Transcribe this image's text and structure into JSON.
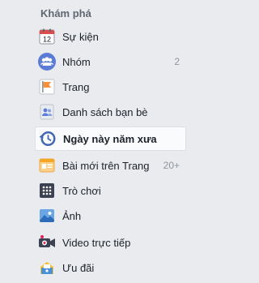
{
  "sidebar": {
    "section_title": "Khám phá",
    "items": [
      {
        "label": "Sự kiện",
        "icon": "calendar-icon",
        "count": "",
        "calendar_day": "12"
      },
      {
        "label": "Nhóm",
        "icon": "groups-icon",
        "count": "2"
      },
      {
        "label": "Trang",
        "icon": "flag-icon",
        "count": ""
      },
      {
        "label": "Danh sách bạn bè",
        "icon": "friends-list-icon",
        "count": ""
      },
      {
        "label": "Ngày này năm xưa",
        "icon": "memories-clock-icon",
        "count": "",
        "active": true
      },
      {
        "label": "Bài mới trên Trang",
        "icon": "pages-feed-icon",
        "count": "20+"
      },
      {
        "label": "Trò chơi",
        "icon": "games-icon",
        "count": ""
      },
      {
        "label": "Ảnh",
        "icon": "photos-icon",
        "count": ""
      },
      {
        "label": "Video trực tiếp",
        "icon": "live-video-icon",
        "count": ""
      },
      {
        "label": "Ưu đãi",
        "icon": "offers-icon",
        "count": ""
      }
    ]
  },
  "colors": {
    "background": "#e9ebee",
    "text": "#1d2129",
    "muted": "#90949c",
    "facebook_blue": "#4267b2"
  }
}
